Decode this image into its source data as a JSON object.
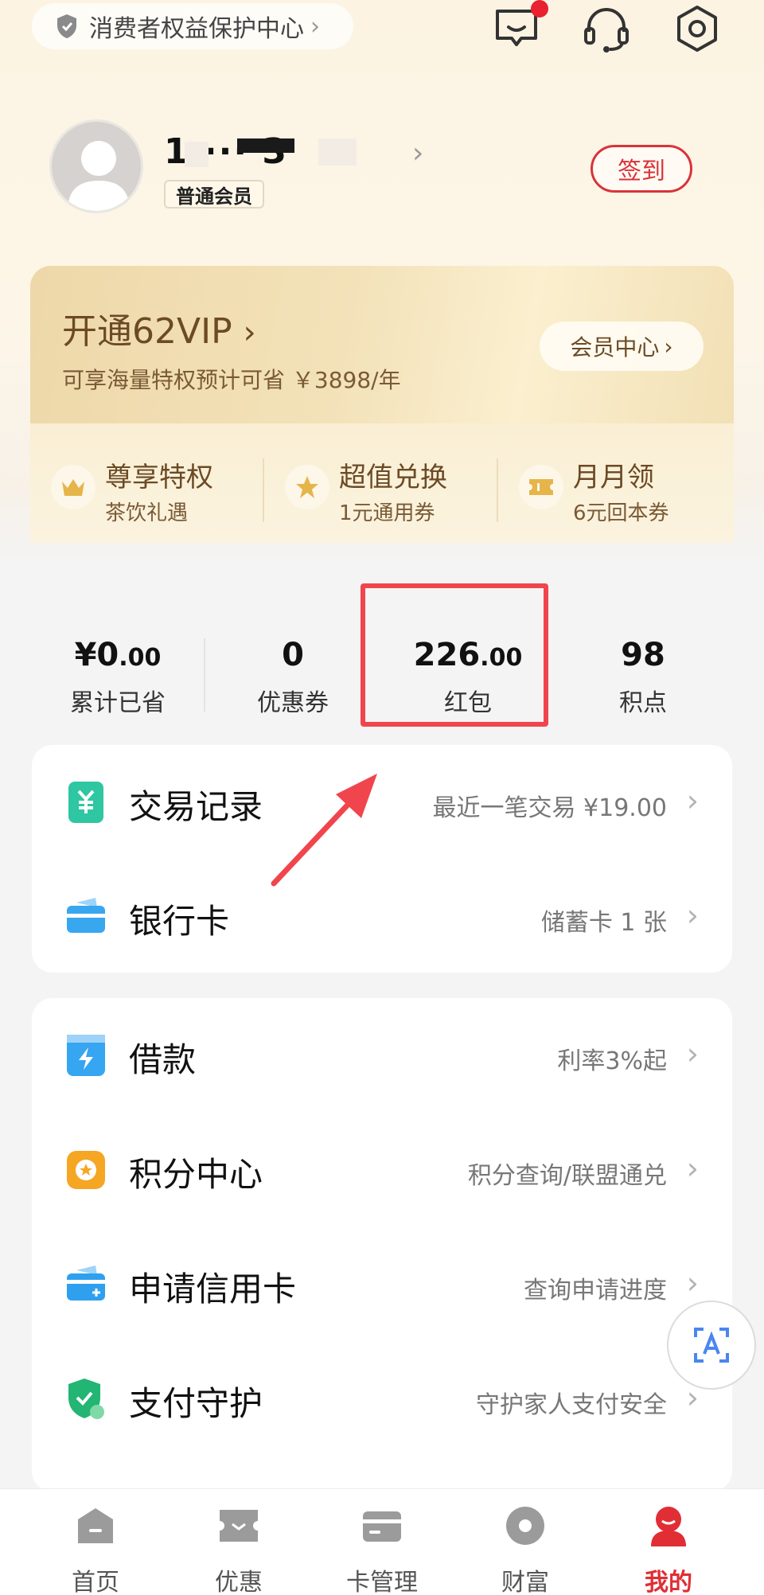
{
  "header": {
    "consumer_protection_label": "消费者权益保护中心",
    "icons": [
      "shield-icon",
      "message-icon",
      "headset-icon",
      "settings-icon"
    ]
  },
  "profile": {
    "username_masked": "1  ··· 3",
    "member_level": "普通会员",
    "signin_label": "签到"
  },
  "vip": {
    "title": "开通62VIP",
    "subtitle": "可享海量特权预计可省 ￥3898/年",
    "member_center_label": "会员中心",
    "perks": [
      {
        "title": "尊享特权",
        "sub": "茶饮礼遇",
        "icon": "crown-icon"
      },
      {
        "title": "超值兑换",
        "sub": "1元通用券",
        "icon": "star-icon"
      },
      {
        "title": "月月领",
        "sub": "6元回本券",
        "icon": "ticket-icon"
      }
    ]
  },
  "stats": {
    "saved": {
      "currency": "¥",
      "int": "0",
      "dec": ".00",
      "label": "累计已省"
    },
    "coupons": {
      "value": "0",
      "label": "优惠券"
    },
    "red_packet": {
      "int": "226",
      "dec": ".00",
      "label": "红包"
    },
    "points": {
      "value": "98",
      "label": "积点"
    }
  },
  "card1": [
    {
      "title": "交易记录",
      "right": "最近一笔交易 ¥19.00",
      "icon": "receipt-icon"
    },
    {
      "title": "银行卡",
      "right": "储蓄卡 1 张",
      "icon": "bank-card-icon"
    }
  ],
  "card2": [
    {
      "title": "借款",
      "right": "利率3%起",
      "icon": "loan-icon"
    },
    {
      "title": "积分中心",
      "right": "积分查询/联盟通兑",
      "icon": "points-icon"
    },
    {
      "title": "申请信用卡",
      "right": "查询申请进度",
      "icon": "credit-card-add-icon"
    },
    {
      "title": "支付守护",
      "right": "守护家人支付安全",
      "icon": "payment-shield-icon"
    }
  ],
  "nav": [
    {
      "label": "首页",
      "icon": "home-icon"
    },
    {
      "label": "优惠",
      "icon": "discount-icon"
    },
    {
      "label": "卡管理",
      "icon": "card-manage-icon"
    },
    {
      "label": "财富",
      "icon": "wealth-icon"
    },
    {
      "label": "我的",
      "icon": "profile-icon",
      "active": true
    }
  ],
  "colors": {
    "accent_red": "#e02e34",
    "vip_gold": "#6b4a25",
    "highlight_box": "#f0454d"
  }
}
